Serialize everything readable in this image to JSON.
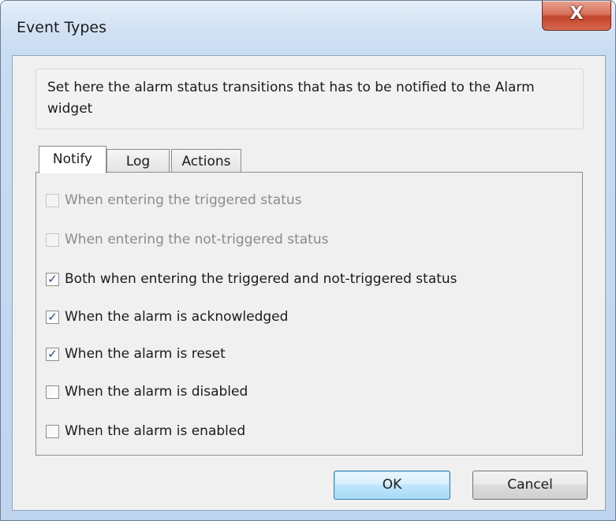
{
  "window": {
    "title": "Event Types",
    "close_glyph": "X",
    "close_icon": "close-icon"
  },
  "description": "Set here the alarm status transitions that has to be notified to the Alarm widget",
  "tabs": [
    {
      "label": "Notify",
      "selected": true
    },
    {
      "label": "Log",
      "selected": false
    },
    {
      "label": "Actions",
      "selected": false
    }
  ],
  "options": [
    {
      "label": "When entering the triggered status",
      "checked": false,
      "enabled": false
    },
    {
      "label": "When entering the not-triggered status",
      "checked": false,
      "enabled": false
    },
    {
      "label": "Both when entering the triggered and not-triggered status",
      "checked": true,
      "enabled": true
    },
    {
      "label": "When the alarm is acknowledged",
      "checked": true,
      "enabled": true
    },
    {
      "label": "When the alarm is reset",
      "checked": true,
      "enabled": true
    },
    {
      "label": "When the alarm is disabled",
      "checked": false,
      "enabled": true
    },
    {
      "label": "When the alarm is enabled",
      "checked": false,
      "enabled": true
    }
  ],
  "buttons": {
    "ok_label": "OK",
    "cancel_label": "Cancel"
  },
  "checkmark_glyph": "✓",
  "colors": {
    "close_button": "#c7503a",
    "default_button_border": "#3c7fb1",
    "checkmark": "#2f4d86",
    "disabled_text": "#8b8b8b"
  }
}
